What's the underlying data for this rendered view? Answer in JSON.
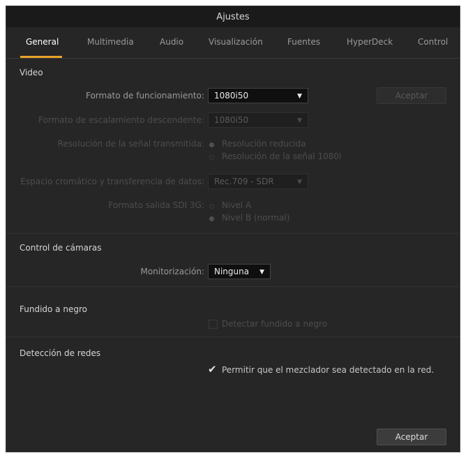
{
  "window": {
    "title": "Ajustes"
  },
  "tabs": [
    {
      "label": "General",
      "active": true
    },
    {
      "label": "Multimedia"
    },
    {
      "label": "Audio"
    },
    {
      "label": "Visualización"
    },
    {
      "label": "Fuentes"
    },
    {
      "label": "HyperDeck"
    },
    {
      "label": "Control"
    }
  ],
  "video": {
    "title": "Video",
    "format_label": "Formato de funcionamiento:",
    "format_value": "1080i50",
    "apply_label": "Aceptar",
    "downscale_label": "Formato de escalamiento descendente:",
    "downscale_value": "1080i50",
    "transmit_label": "Resolución de la señal transmitida:",
    "transmit_opt1": "Resolución reducida",
    "transmit_opt2": "Resolución de la señal 1080i",
    "colorspace_label": "Espacio cromático y transferencia de datos:",
    "colorspace_value": "Rec.709 - SDR",
    "sdi3g_label": "Formato salida SDI 3G:",
    "sdi3g_opt1": "Nivel A",
    "sdi3g_opt2": "Nivel B (normal)"
  },
  "camera": {
    "title": "Control de cámaras",
    "monitor_label": "Monitorización:",
    "monitor_value": "Ninguna"
  },
  "fade": {
    "title": "Fundido a negro",
    "detect_label": "Detectar fundido a negro"
  },
  "network": {
    "title": "Detección de redes",
    "allow_label": "Permitir que el mezclador sea detectado en la red.",
    "allow_checked": true
  },
  "footer": {
    "ok_label": "Aceptar"
  },
  "colors": {
    "accent": "#e8a32a",
    "background": "#262626",
    "titlebar": "#1a1a1a"
  }
}
